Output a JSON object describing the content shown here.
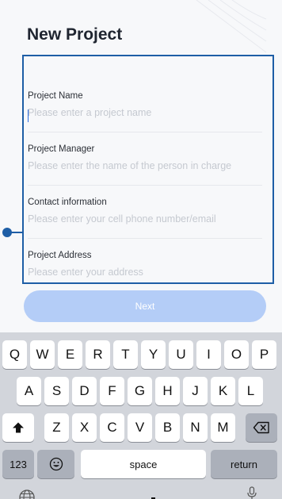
{
  "header": {
    "title": "New Project"
  },
  "form": {
    "fields": [
      {
        "label": "Project Name",
        "placeholder": "Please enter a project name"
      },
      {
        "label": "Project Manager",
        "placeholder": "Please enter the name of the person in charge"
      },
      {
        "label": "Contact information",
        "placeholder": "Please enter your cell phone number/email"
      },
      {
        "label": "Project Address",
        "placeholder": "Please enter your address"
      }
    ],
    "next_label": "Next"
  },
  "keyboard": {
    "row1": [
      "Q",
      "W",
      "E",
      "R",
      "T",
      "Y",
      "U",
      "I",
      "O",
      "P"
    ],
    "row2": [
      "A",
      "S",
      "D",
      "F",
      "G",
      "H",
      "J",
      "K",
      "L"
    ],
    "row3": [
      "Z",
      "X",
      "C",
      "V",
      "B",
      "N",
      "M"
    ],
    "numbers_label": "123",
    "space_label": "space",
    "return_label": "return",
    "icons": {
      "shift": "shift-icon",
      "backspace": "backspace-icon",
      "emoji": "emoji-icon",
      "globe": "globe-icon",
      "microphone": "microphone-icon"
    }
  },
  "colors": {
    "accent": "#1e5ea6",
    "next_button": "#b4cdf7",
    "keyboard_background": "#d2d5db"
  }
}
